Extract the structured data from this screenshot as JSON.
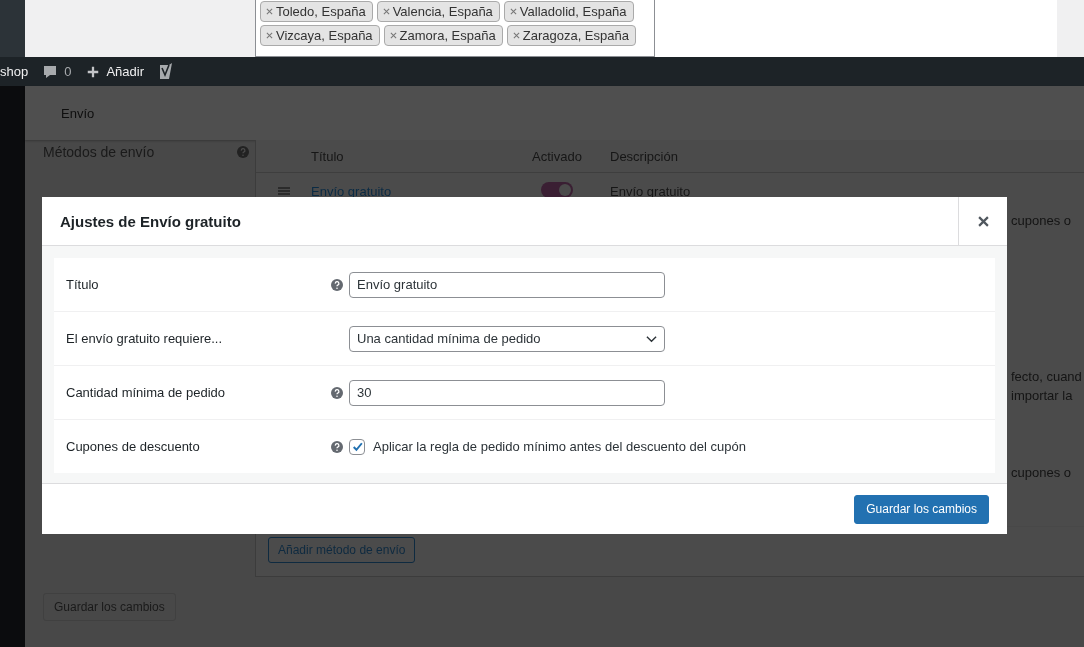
{
  "top_panel": {
    "tags": [
      "Toledo, España",
      "Valencia, España",
      "Valladolid, España",
      "Vizcaya, España",
      "Zamora, España",
      "Zaragoza, España"
    ]
  },
  "admin_bar": {
    "site": "shop",
    "comments": "0",
    "new": "Añadir"
  },
  "header": {
    "title": "Envío"
  },
  "sidebar_section": {
    "title": "Métodos de envío"
  },
  "methods_table": {
    "columns": [
      "Título",
      "Activado",
      "Descripción"
    ],
    "rows": [
      {
        "title": "Envío gratuito",
        "enabled": true,
        "description": "Envío gratuito"
      }
    ],
    "description_fragments": [
      "cupones o",
      "fecto, cuand",
      "importar la",
      "cupones o"
    ],
    "add_button": "Añadir método de envío"
  },
  "save_button": {
    "label": "Guardar los cambios",
    "disabled": true
  },
  "modal": {
    "title": "Ajustes de Envío gratuito",
    "fields": [
      {
        "kind": "text",
        "label": "Título",
        "help": true,
        "value": "Envío gratuito"
      },
      {
        "kind": "select",
        "label": "El envío gratuito requiere...",
        "help": false,
        "value": "Una cantidad mínima de pedido"
      },
      {
        "kind": "text",
        "label": "Cantidad mínima de pedido",
        "help": true,
        "value": "30"
      },
      {
        "kind": "checkbox",
        "label": "Cupones de descuento",
        "help": true,
        "checked": true,
        "text": "Aplicar la regla de pedido mínimo antes del descuento del cupón"
      }
    ],
    "save_button": "Guardar los cambios"
  }
}
